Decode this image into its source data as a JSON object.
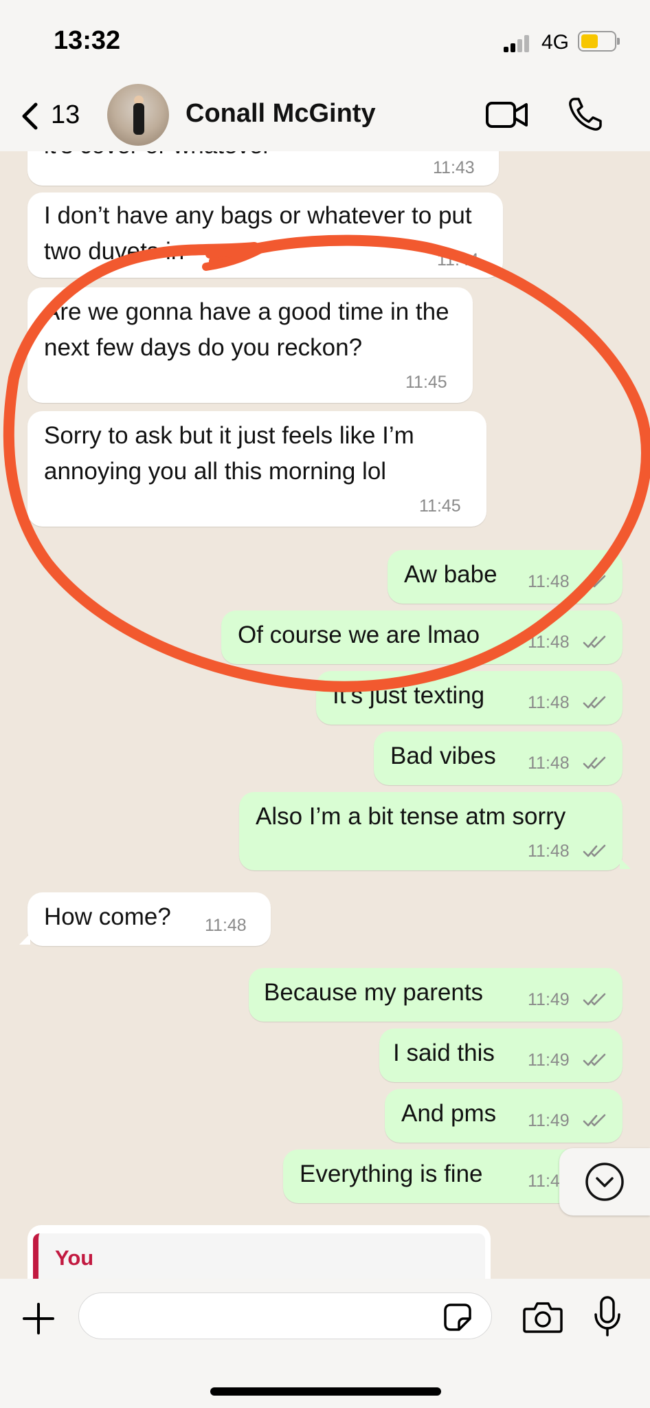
{
  "status_bar": {
    "time": "13:32",
    "network": "4G"
  },
  "header": {
    "back_count": "13",
    "contact_name": "Conall McGinty"
  },
  "messages": [
    {
      "dir": "in",
      "text": "it’s cover or whatever",
      "time": "11:43"
    },
    {
      "dir": "in",
      "text": "I don’t have any bags or whatever to put two duvets in",
      "time": "11:44"
    },
    {
      "dir": "in",
      "text": "Are we gonna have a good time in the next few days do you reckon?",
      "time": "11:45"
    },
    {
      "dir": "in",
      "text": "Sorry to ask but it just feels like I’m annoying you all this morning lol",
      "time": "11:45"
    },
    {
      "dir": "out",
      "text": "Aw babe",
      "time": "11:48",
      "read": true
    },
    {
      "dir": "out",
      "text": "Of course we are lmao",
      "time": "11:48",
      "read": true
    },
    {
      "dir": "out",
      "text": "It’s just texting",
      "time": "11:48",
      "read": true
    },
    {
      "dir": "out",
      "text": "Bad vibes",
      "time": "11:48",
      "read": true
    },
    {
      "dir": "out",
      "text": "Also I’m a bit tense atm sorry",
      "time": "11:48",
      "read": true
    },
    {
      "dir": "in",
      "text": "How come?",
      "time": "11:48"
    },
    {
      "dir": "out",
      "text": "Because my parents",
      "time": "11:49",
      "read": true
    },
    {
      "dir": "out",
      "text": "I said this",
      "time": "11:49",
      "read": true
    },
    {
      "dir": "out",
      "text": "And pms",
      "time": "11:49",
      "read": true
    },
    {
      "dir": "out",
      "text": "Everything is fine",
      "time": "11:49",
      "read": true
    }
  ],
  "reply_preview": {
    "sender": "You"
  },
  "composer": {
    "placeholder": ""
  },
  "colors": {
    "incoming": "#ffffff",
    "outgoing": "#d9fdd3",
    "read_ticks": "#53bdeb",
    "annotation": "#f2592f",
    "reply_accent": "#c21a41"
  },
  "icons": [
    "back-chevron-icon",
    "video-call-icon",
    "phone-icon",
    "plus-icon",
    "sticker-icon",
    "camera-icon",
    "mic-icon",
    "chevron-down-icon"
  ]
}
